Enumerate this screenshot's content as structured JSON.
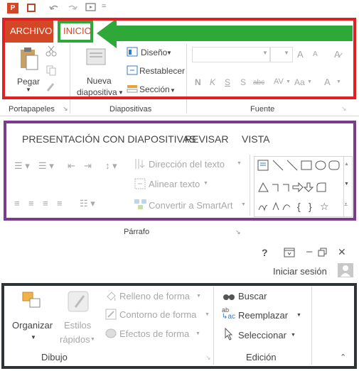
{
  "qat": {
    "app_icon": "powerpoint-icon",
    "save_icon": "save-icon",
    "undo_icon": "undo-icon",
    "redo_icon": "redo-icon",
    "start_icon": "start-from-beginning-icon",
    "more_glyph": "="
  },
  "tabs": {
    "file": "ARCHIVO",
    "home": "INICIO",
    "slideshow": "PRESENTACIÓN CON DIAPOSITIVAS",
    "review": "REVISAR",
    "view": "VISTA"
  },
  "clipboard": {
    "paste": "Pegar",
    "group": "Portapapeles"
  },
  "slides": {
    "new_line1": "Nueva",
    "new_line2": "diapositiva",
    "layout": "Diseño",
    "reset": "Restablecer",
    "section": "Sección",
    "group": "Diapositivas"
  },
  "font": {
    "group": "Fuente",
    "grow": "A",
    "shrink": "A",
    "bold": "N",
    "italic": "K",
    "underline": "S",
    "shadow": "S",
    "strike": "abc",
    "spacing": "AV",
    "case": "Aa",
    "color": "A"
  },
  "paragraph": {
    "text_direction": "Dirección del texto",
    "align_text": "Alinear texto",
    "smartart": "Convertir a SmartArt",
    "group": "Párrafo"
  },
  "window": {
    "help": "?",
    "minimize": "–",
    "close": "✕",
    "signin": "Iniciar sesión"
  },
  "drawing": {
    "arrange": "Organizar",
    "styles_line1": "Estilos",
    "styles_line2": "rápidos",
    "fill": "Relleno de forma",
    "outline": "Contorno de forma",
    "effects": "Efectos de forma",
    "group": "Dibujo"
  },
  "editing": {
    "find": "Buscar",
    "replace": "Reemplazar",
    "select": "Seleccionar",
    "group": "Edición",
    "replace_icon_text": "ab"
  },
  "colors": {
    "red_box": "#e02020",
    "green_box": "#2fa83a",
    "purple_box": "#7a3c8c",
    "dark_box": "#2e3436",
    "archivo_bg": "#d24726",
    "arrow": "#2fa83a"
  }
}
